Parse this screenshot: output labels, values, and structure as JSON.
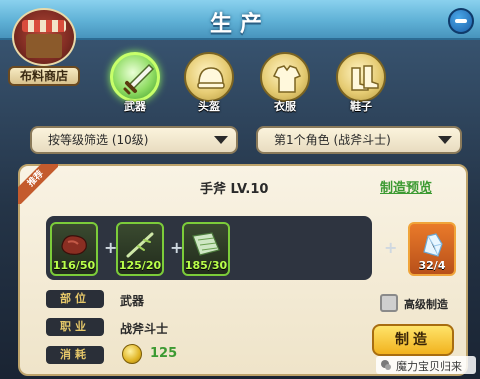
{
  "header": {
    "title": "生产"
  },
  "shop": {
    "label": "布料商店"
  },
  "categories": [
    {
      "label": "武器",
      "active": true,
      "icon": "sword-icon"
    },
    {
      "label": "头盔",
      "active": false,
      "icon": "helmet-icon"
    },
    {
      "label": "衣服",
      "active": false,
      "icon": "armor-icon"
    },
    {
      "label": "鞋子",
      "active": false,
      "icon": "boots-icon"
    }
  ],
  "filters": {
    "level": "按等级筛选 (10级)",
    "character": "第1个角色 (战斧斗士)"
  },
  "recipe": {
    "badge": "推荐",
    "item_name": "手斧 LV.10",
    "preview_link": "制造预览",
    "materials": [
      {
        "count": "116/50",
        "icon": "meat-icon"
      },
      {
        "count": "125/20",
        "icon": "branch-icon"
      },
      {
        "count": "185/30",
        "icon": "cloth-icon"
      }
    ],
    "result": {
      "count": "32/4",
      "icon": "crystal-icon"
    },
    "details": [
      {
        "label": "部位",
        "value": "武器"
      },
      {
        "label": "职业",
        "value": "战斧斗士"
      },
      {
        "label": "消耗",
        "value": "125"
      }
    ],
    "advanced_label": "高级制造",
    "craft_button": "制造"
  },
  "watermark": {
    "text": "魔力宝贝归来"
  },
  "colors": {
    "accent_green": "#3c9a32",
    "count_green": "#b9ff4a",
    "gold": "#e0b424"
  }
}
